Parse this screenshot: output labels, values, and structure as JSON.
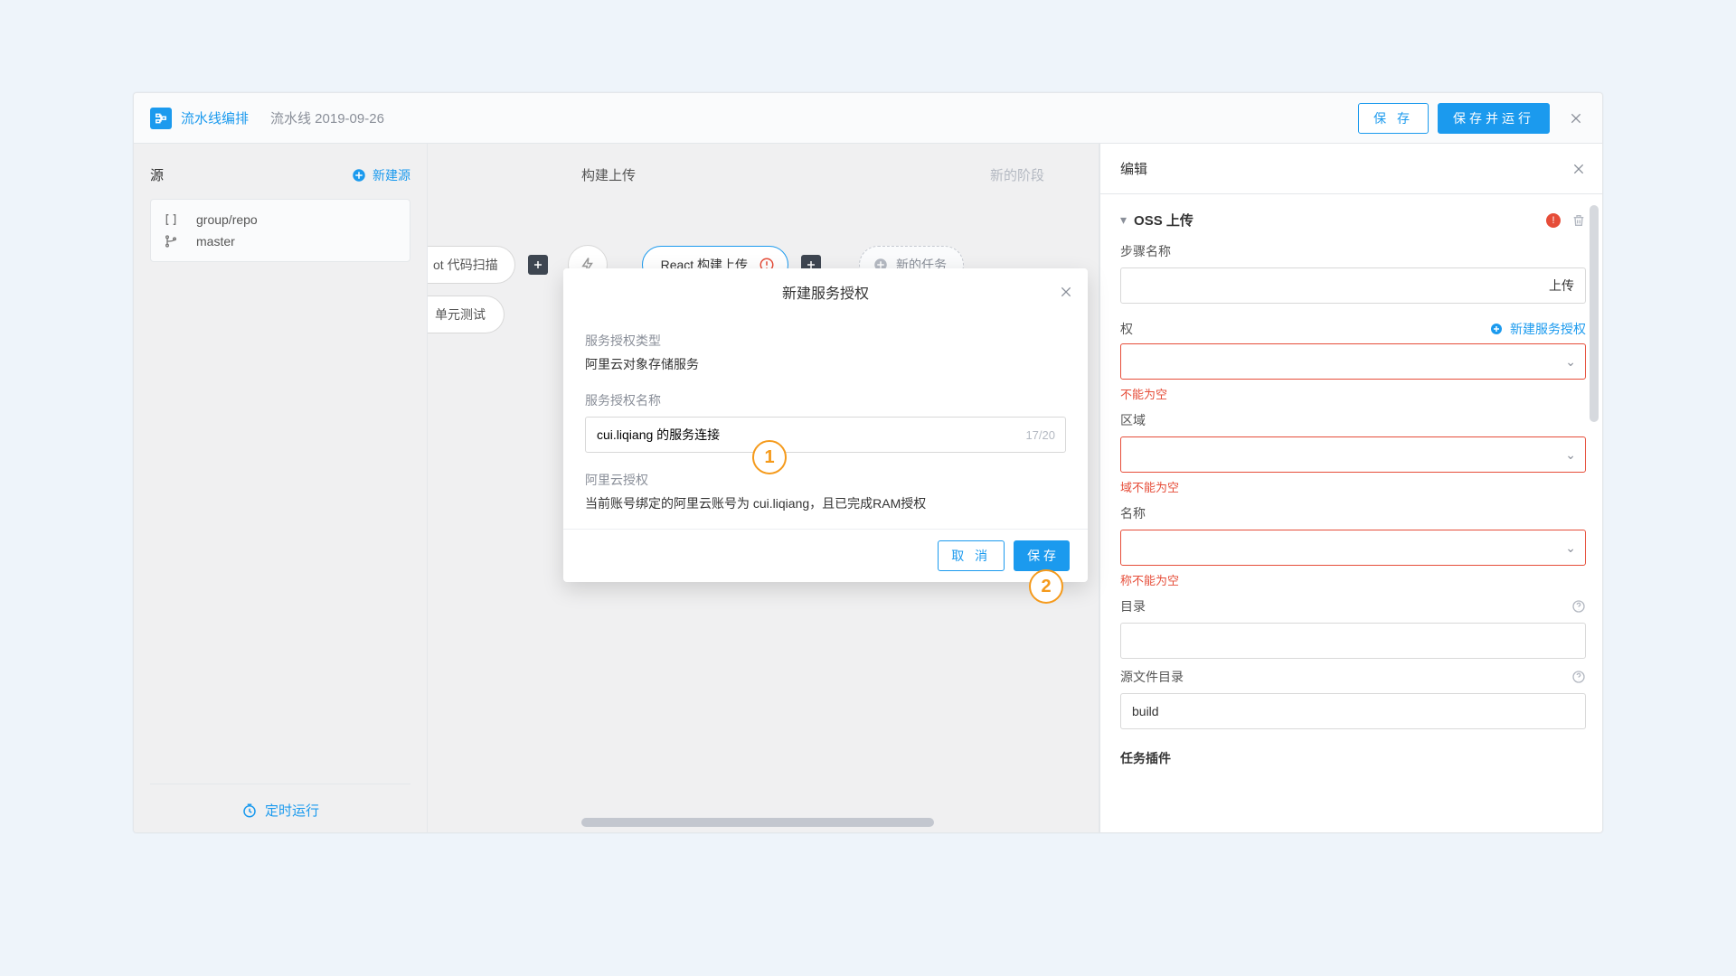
{
  "topbar": {
    "title": "流水线编排",
    "pipeline_name": "流水线 2019-09-26",
    "saveLabel": "保 存",
    "saveRunLabel": "保存并运行"
  },
  "left": {
    "title": "源",
    "newSource": "新建源",
    "repo": "group/repo",
    "branch": "master",
    "schedule": "定时运行"
  },
  "mid": {
    "stageLabel": "构建上传",
    "newStage": "新的阶段",
    "codeScanFrag": "ot 代码扫描",
    "unitTest": "单元测试",
    "reactBuild": "React 构建上传",
    "newTask": "新的任务"
  },
  "right": {
    "title": "编辑",
    "section": "OSS 上传",
    "stepNameLabel": "步骤名称",
    "stepNameValue": "上传",
    "authLabel": "权",
    "newAuth": "新建服务授权",
    "err1": "不能为空",
    "regionLabel": "区域",
    "err2": "域不能为空",
    "bucketLabel": "名称",
    "err3": "称不能为空",
    "dirLabel": "目录",
    "srcDirLabel": "源文件目录",
    "srcDirValue": "build",
    "pluginsLabel": "任务插件"
  },
  "modal": {
    "title": "新建服务授权",
    "typeLabel": "服务授权类型",
    "typeValue": "阿里云对象存储服务",
    "nameLabel": "服务授权名称",
    "nameValue": "cui.liqiang 的服务连接",
    "nameCount": "17/20",
    "aliLabel": "阿里云授权",
    "aliDesc": "当前账号绑定的阿里云账号为 cui.liqiang，且已完成RAM授权",
    "cancel": "取 消",
    "save": "保 存"
  },
  "annotations": {
    "a1": "1",
    "a2": "2"
  }
}
